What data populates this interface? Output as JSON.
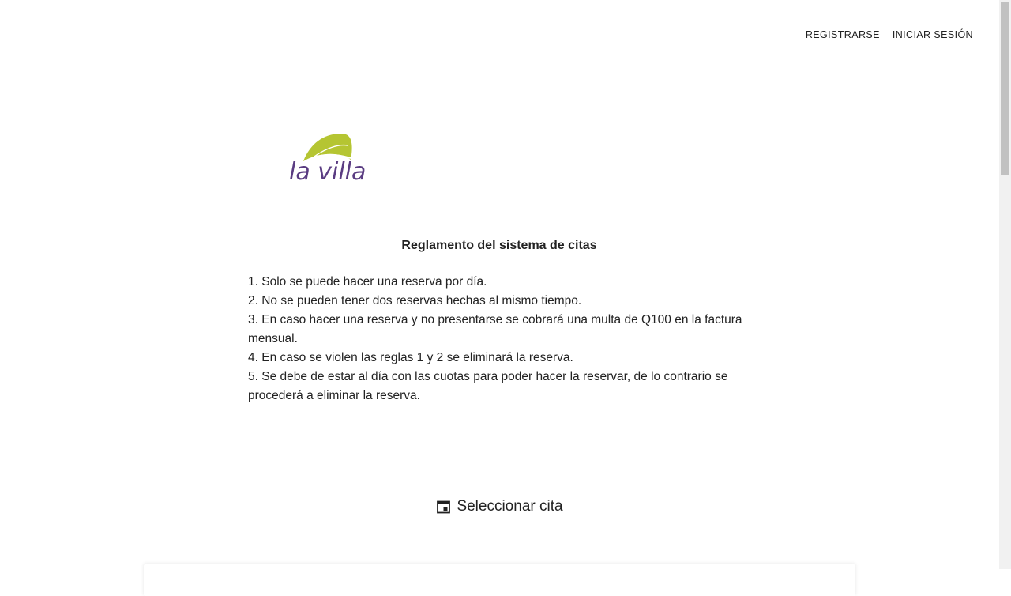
{
  "header": {
    "register_label": "REGISTRARSE",
    "login_label": "INICIAR SESIÓN"
  },
  "logo": {
    "text": "la villa",
    "leaf_color": "#b5c532",
    "text_color": "#5a3c82"
  },
  "rules": {
    "title": "Reglamento del sistema de citas",
    "items": [
      "1. Solo se puede hacer una reserva por día.",
      "2. No se pueden tener dos reservas hechas al mismo tiempo.",
      "3. En caso hacer una reserva y no presentarse se cobrará una multa de Q100 en la factura mensual.",
      "4. En caso se violen las reglas 1 y 2 se eliminará la reserva.",
      "5. Se debe de estar al día con las cuotas para poder hacer la reservar, de lo contrario se procederá a eliminar la reserva."
    ]
  },
  "select_appointment": {
    "icon": "calendar-icon",
    "label": "Seleccionar cita"
  }
}
